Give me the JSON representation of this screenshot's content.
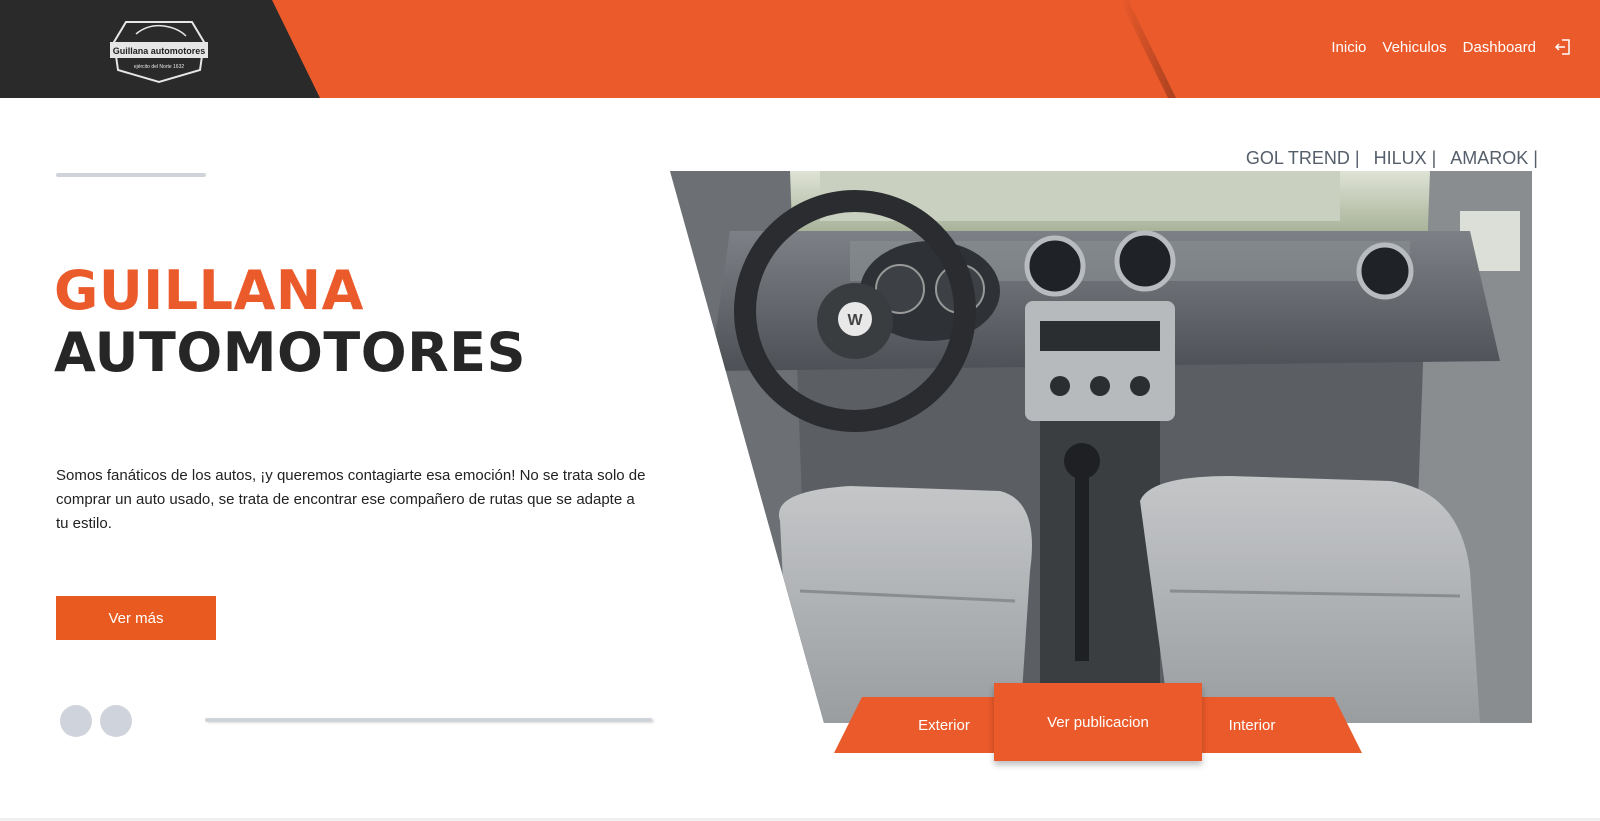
{
  "brand": {
    "logo_text": "Guillana automotores",
    "logo_subtext": "ejército del Norte 1632"
  },
  "nav": {
    "items": [
      "Inicio",
      "Vehiculos",
      "Dashboard"
    ],
    "logout_icon": "logout-icon"
  },
  "hero": {
    "title_line1": "GUILLANA",
    "title_line2": "AUTOMOTORES",
    "description": "Somos fanáticos de los autos, ¡y queremos contagiarte esa emoción! No se trata solo de comprar un auto usado, se trata de encontrar ese compañero de rutas que se adapte a tu estilo.",
    "cta_label": "Ver más",
    "slide_dots": 2
  },
  "models": [
    "GOL TREND |",
    "HILUX |",
    "AMAROK |"
  ],
  "photo": {
    "subject": "car-interior-dashboard"
  },
  "tabs": {
    "left": "Exterior",
    "center": "Ver publicacion",
    "right": "Interior"
  },
  "colors": {
    "accent": "#eb5a2b",
    "dark": "#2a2a2a",
    "muted": "#cfd3db"
  }
}
